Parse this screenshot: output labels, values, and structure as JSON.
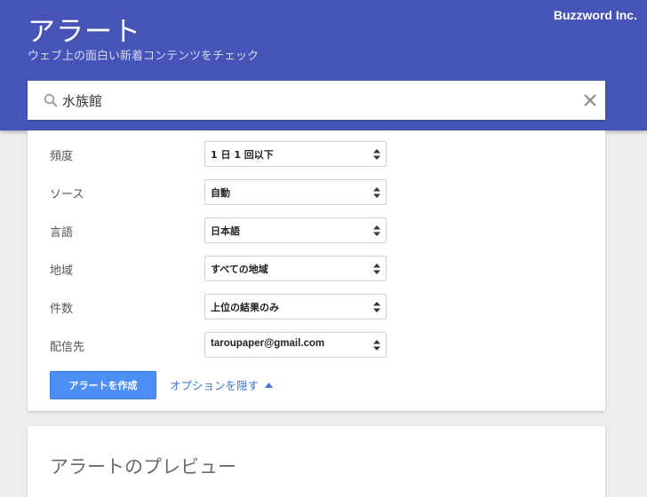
{
  "header": {
    "title": "アラート",
    "subtitle": "ウェブ上の面白い新着コンテンツをチェック",
    "brand": "Buzzword Inc."
  },
  "search": {
    "value": "水族館",
    "icon": "search-icon",
    "clear_icon": "close-icon"
  },
  "options": {
    "rows": [
      {
        "label": "頻度",
        "value": "1 日 1 回以下"
      },
      {
        "label": "ソース",
        "value": "自動"
      },
      {
        "label": "言語",
        "value": "日本語"
      },
      {
        "label": "地域",
        "value": "すべての地域"
      },
      {
        "label": "件数",
        "value": "上位の結果のみ"
      },
      {
        "label": "配信先",
        "value": "taroupaper@gmail.com"
      }
    ],
    "create_button": "アラートを作成",
    "hide_link": "オプションを隠す"
  },
  "preview": {
    "title": "アラートのプレビュー"
  },
  "colors": {
    "header_bg": "#4654b8",
    "button_bg": "#4d8ff4",
    "link": "#3d76d6",
    "page_bg": "#eeeeee"
  }
}
